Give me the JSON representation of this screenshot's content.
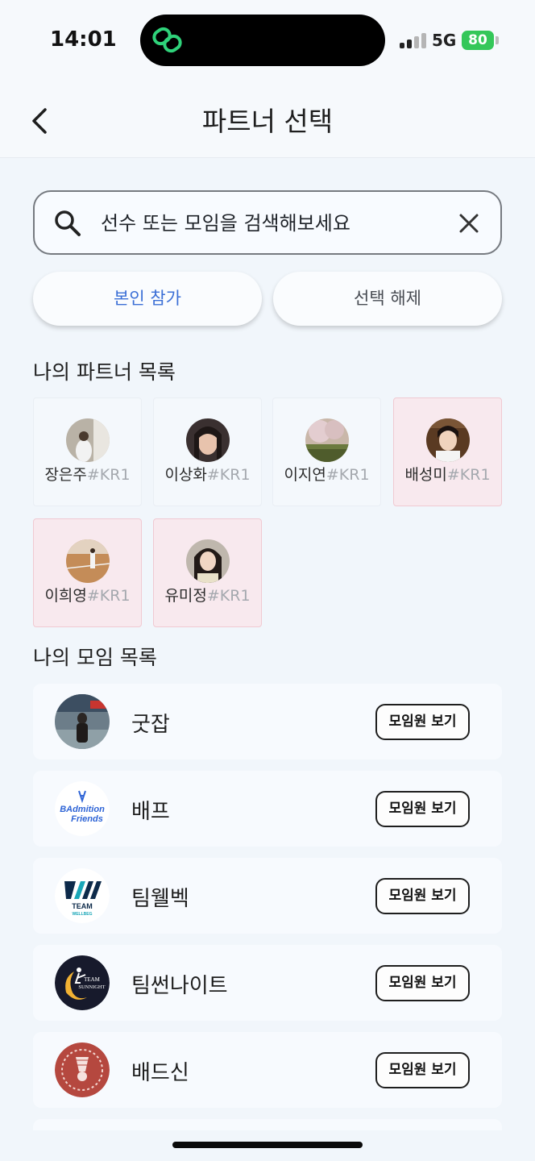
{
  "status_bar": {
    "time": "14:01",
    "network": "5G",
    "battery": "80",
    "island_icon": "link-icon"
  },
  "header": {
    "title": "파트너 선택",
    "back_icon": "chevron-left-icon"
  },
  "search": {
    "placeholder": "선수 또는 모임을 검색해보세요",
    "value": "",
    "search_icon": "search-icon",
    "clear_icon": "close-icon"
  },
  "actions": {
    "join_self": "본인 참가",
    "deselect": "선택 해제"
  },
  "colors": {
    "accent": "#3b6fd6",
    "selected_card": "#f8e9ee",
    "battery": "#34c759"
  },
  "partners_section": {
    "title": "나의 파트너 목록",
    "items": [
      {
        "name": "장은주",
        "tag": "#KR1",
        "selected": false
      },
      {
        "name": "이상화",
        "tag": "#KR1",
        "selected": false
      },
      {
        "name": "이지연",
        "tag": "#KR1",
        "selected": false
      },
      {
        "name": "배성미",
        "tag": "#KR1",
        "selected": true
      },
      {
        "name": "이희영",
        "tag": "#KR1",
        "selected": true
      },
      {
        "name": "유미정",
        "tag": "#KR1",
        "selected": true
      }
    ]
  },
  "clubs_section": {
    "title": "나의 모임 목록",
    "items": [
      {
        "name": "굿잡",
        "button": "모임원 보기"
      },
      {
        "name": "배프",
        "button": "모임원 보기",
        "logo_text": [
          "BAdmition",
          "Friends"
        ]
      },
      {
        "name": "팀웰벡",
        "button": "모임원 보기",
        "logo_text": [
          "TEAM",
          "WELLBEG"
        ]
      },
      {
        "name": "팀썬나이트",
        "button": "모임원 보기",
        "logo_text": [
          "TEAM",
          "SUNNIGHT"
        ]
      },
      {
        "name": "배드신",
        "button": "모임원 보기"
      }
    ]
  }
}
